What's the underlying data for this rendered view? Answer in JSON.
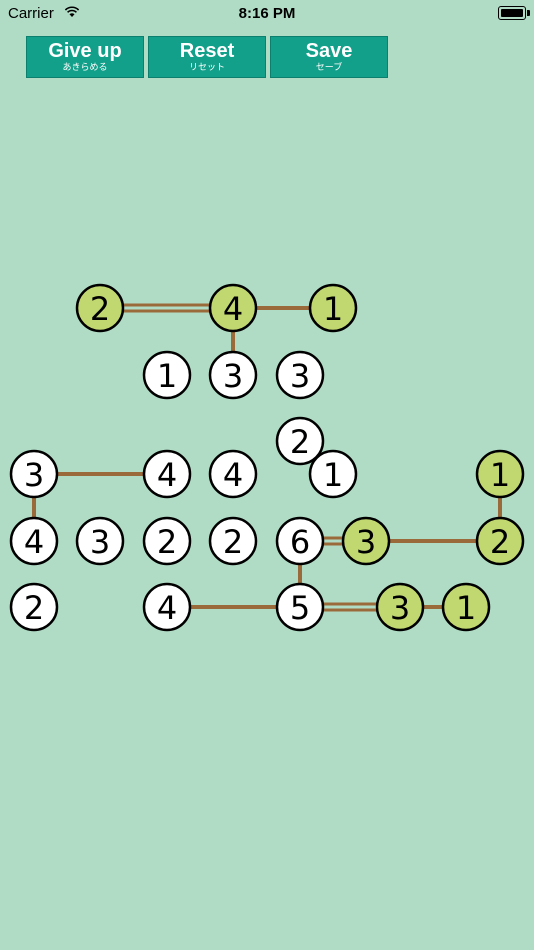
{
  "status": {
    "carrier": "Carrier",
    "time": "8:16 PM"
  },
  "toolbar": {
    "buttons": [
      {
        "label": "Give up",
        "sub": "あきらめる"
      },
      {
        "label": "Reset",
        "sub": "リセット"
      },
      {
        "label": "Save",
        "sub": "セーブ"
      }
    ]
  },
  "colors": {
    "background": "#b0dcc5",
    "button": "#13a08a",
    "bridge": "#9b6a3b",
    "island_complete": "#c1d770",
    "island_open": "#ffffff"
  },
  "board": {
    "islands": [
      {
        "id": "a",
        "value": "2",
        "complete": true
      },
      {
        "id": "b",
        "value": "4",
        "complete": true
      },
      {
        "id": "c",
        "value": "1",
        "complete": true
      },
      {
        "id": "d",
        "value": "1",
        "complete": false
      },
      {
        "id": "e",
        "value": "3",
        "complete": false
      },
      {
        "id": "f",
        "value": "3",
        "complete": false
      },
      {
        "id": "g",
        "value": "2",
        "complete": false
      },
      {
        "id": "h",
        "value": "3",
        "complete": false
      },
      {
        "id": "i",
        "value": "4",
        "complete": false
      },
      {
        "id": "j",
        "value": "4",
        "complete": false
      },
      {
        "id": "k",
        "value": "1",
        "complete": false
      },
      {
        "id": "l",
        "value": "1",
        "complete": true
      },
      {
        "id": "m",
        "value": "4",
        "complete": false
      },
      {
        "id": "n",
        "value": "3",
        "complete": false
      },
      {
        "id": "o",
        "value": "2",
        "complete": false
      },
      {
        "id": "p",
        "value": "2",
        "complete": false
      },
      {
        "id": "q",
        "value": "6",
        "complete": false
      },
      {
        "id": "r",
        "value": "3",
        "complete": true
      },
      {
        "id": "s",
        "value": "2",
        "complete": true
      },
      {
        "id": "t",
        "value": "2",
        "complete": false
      },
      {
        "id": "u",
        "value": "4",
        "complete": false
      },
      {
        "id": "v",
        "value": "5",
        "complete": false
      },
      {
        "id": "w",
        "value": "3",
        "complete": true
      },
      {
        "id": "x",
        "value": "1",
        "complete": true
      }
    ],
    "bridges": [
      {
        "from": "a",
        "to": "b",
        "count": 2
      },
      {
        "from": "b",
        "to": "c",
        "count": 1
      },
      {
        "from": "b",
        "to": "e",
        "count": 1
      },
      {
        "from": "h",
        "to": "i",
        "count": 1
      },
      {
        "from": "h",
        "to": "m",
        "count": 1
      },
      {
        "from": "q",
        "to": "r",
        "count": 2
      },
      {
        "from": "r",
        "to": "s",
        "count": 1
      },
      {
        "from": "l",
        "to": "s",
        "count": 1
      },
      {
        "from": "q",
        "to": "v",
        "count": 1
      },
      {
        "from": "u",
        "to": "v",
        "count": 1
      },
      {
        "from": "v",
        "to": "w",
        "count": 2
      },
      {
        "from": "w",
        "to": "x",
        "count": 1
      }
    ]
  }
}
